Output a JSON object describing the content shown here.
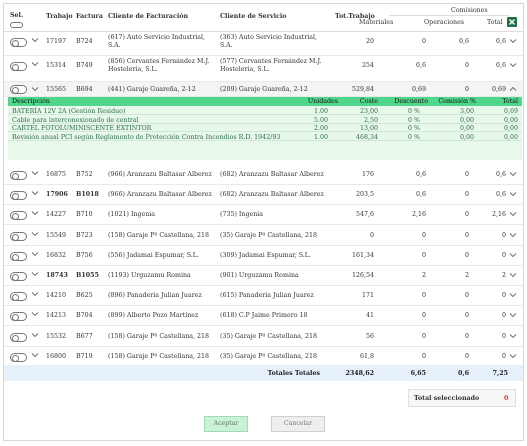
{
  "header": {
    "sel": "Sel.",
    "trabajo": "Trabajo",
    "factura": "Factura",
    "cliente_facturacion": "Cliente de Facturación",
    "cliente_servicio": "Cliente de Servicio",
    "tot_trabajo": "Tot.Trabajo",
    "comisiones": "Comisiones",
    "materiales": "Materiales",
    "operaciones": "Operaciones",
    "total": "Total"
  },
  "rows_top": [
    {
      "trabajo": "17197",
      "factura": "B724",
      "cli_fact": "(617) Auto Servicio Industrial, S.A.",
      "cli_serv": "(363) Auto Servicio Industrial, S.A.",
      "tot": "20",
      "mat": "0",
      "oper": "0,6",
      "total": "0,6"
    },
    {
      "trabajo": "15314",
      "factura": "B749",
      "cli_fact": "(856) Cervantes Fernández M.J. Hostelería, S.L.",
      "cli_serv": "(577) Cervantes Fernández M.J. Hostelería, S.L.",
      "tot": "254",
      "mat": "0,6",
      "oper": "0",
      "total": "0,6"
    },
    {
      "trabajo": "15565",
      "factura": "B694",
      "cli_fact": "(441) Garaje Guareña, 2-12",
      "cli_serv": "(209) Garaje Guareña, 2-12",
      "tot": "529,84",
      "mat": "0,69",
      "oper": "0",
      "total": "0,69"
    }
  ],
  "detail": {
    "headers": {
      "descripcion": "Descripción",
      "unidades": "Unidades",
      "coste": "Coste",
      "descuento": "Descuento",
      "comision": "Comisión %",
      "total": "Total"
    },
    "lines": [
      {
        "desc": "BATERÍA 12V 2A (Gestión Residuo)",
        "unid": "1.00",
        "coste": "23,00",
        "desc_pct": "0 %",
        "com": "3,00",
        "total": "0,69"
      },
      {
        "desc": "Cable para interconexionado de central",
        "unid": "5.00",
        "coste": "2,50",
        "desc_pct": "0 %",
        "com": "0,00",
        "total": "0,00"
      },
      {
        "desc": "CARTEL FOTOLUMINISCENTE EXTINTOR",
        "unid": "2.00",
        "coste": "13,00",
        "desc_pct": "0 %",
        "com": "0,00",
        "total": "0,00"
      },
      {
        "desc": "Revisión anual PCI según Reglamento de Protección Contra Incendios R.D. 1942/93",
        "unid": "1.00",
        "coste": "468,34",
        "desc_pct": "0 %",
        "com": "0,00",
        "total": "0,00"
      }
    ]
  },
  "rows_bottom": [
    {
      "trabajo": "16875",
      "factura": "B752",
      "cli_fact": "(966) Aranzazu Baltasar Alberez",
      "cli_serv": "(682) Aranzazu Baltasar Alberez",
      "tot": "176",
      "mat": "0,6",
      "oper": "0",
      "total": "0,6",
      "bold": false
    },
    {
      "trabajo": "17906",
      "factura": "B1018",
      "cli_fact": "(966) Aranzazu Baltasar Alberez",
      "cli_serv": "(682) Aranzazu Baltasar Alberez",
      "tot": "203,5",
      "mat": "0,6",
      "oper": "0",
      "total": "0,6",
      "bold": true
    },
    {
      "trabajo": "14227",
      "factura": "B710",
      "cli_fact": "(1021) Ingenia",
      "cli_serv": "(735) Ingenia",
      "tot": "547,6",
      "mat": "2,16",
      "oper": "0",
      "total": "2,16",
      "bold": false
    },
    {
      "trabajo": "15549",
      "factura": "B723",
      "cli_fact": "(158) Garaje Pº Castellana, 218",
      "cli_serv": "(35) Garaje Pº Castellana, 218",
      "tot": "0",
      "mat": "0",
      "oper": "0",
      "total": "0",
      "bold": false
    },
    {
      "trabajo": "16832",
      "factura": "B756",
      "cli_fact": "(556) Jadamai Espumar, S.L.",
      "cli_serv": "(309) Jadamai Espumar, S.L.",
      "tot": "161,34",
      "mat": "0",
      "oper": "0",
      "total": "0",
      "bold": false
    },
    {
      "trabajo": "18743",
      "factura": "B1055",
      "cli_fact": "(1193) Urguzamu Romina",
      "cli_serv": "(901) Urguzamu Romina",
      "tot": "126,54",
      "mat": "2",
      "oper": "2",
      "total": "2",
      "bold": true
    },
    {
      "trabajo": "14210",
      "factura": "B625",
      "cli_fact": "(896) Panaderia Julian Juarez",
      "cli_serv": "(615) Panaderia Julian Juarez",
      "tot": "171",
      "mat": "0",
      "oper": "0",
      "total": "0",
      "bold": false
    },
    {
      "trabajo": "14213",
      "factura": "B704",
      "cli_fact": "(899) Alberto Pozo Martínez",
      "cli_serv": "(618) C.P Jaime Primero 18",
      "tot": "41",
      "mat": "0",
      "oper": "0",
      "total": "0",
      "bold": false
    },
    {
      "trabajo": "15532",
      "factura": "B677",
      "cli_fact": "(158) Garaje Pº Castellana, 218",
      "cli_serv": "(35) Garaje Pº Castellana, 218",
      "tot": "56",
      "mat": "0",
      "oper": "0",
      "total": "0",
      "bold": false
    },
    {
      "trabajo": "16800",
      "factura": "B719",
      "cli_fact": "(158) Garaje Pº Castellana, 218",
      "cli_serv": "(35) Garaje Pº Castellana, 218",
      "tot": "61,8",
      "mat": "0",
      "oper": "0",
      "total": "0",
      "bold": false
    }
  ],
  "totals": {
    "label": "Totales Totales",
    "tot": "2348,62",
    "mat": "6,65",
    "oper": "0,6",
    "total": "7,25"
  },
  "selected": {
    "label": "Total seleccionado",
    "value": "0"
  },
  "buttons": {
    "accept": "Aceptar",
    "cancel": "Cancelar"
  },
  "colors": {
    "accent": "#4fd68a",
    "detail_bg": "#e8f9ec",
    "totals_bg": "#e7f1fb",
    "selected_value": "#e53935",
    "excel": "#1e7145"
  },
  "icons": {
    "excel": "excel-icon",
    "toggle": "toggle-icon",
    "chevron": "chevron-down-icon"
  }
}
